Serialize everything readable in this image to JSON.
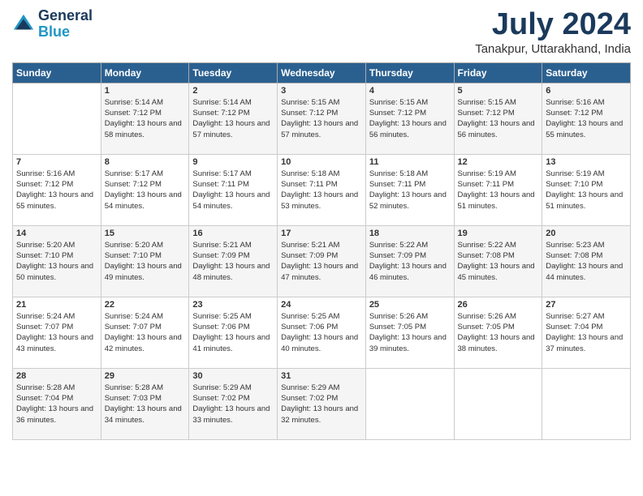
{
  "header": {
    "logo_line1": "General",
    "logo_line2": "Blue",
    "month_title": "July 2024",
    "location": "Tanakpur, Uttarakhand, India"
  },
  "days_of_week": [
    "Sunday",
    "Monday",
    "Tuesday",
    "Wednesday",
    "Thursday",
    "Friday",
    "Saturday"
  ],
  "weeks": [
    [
      {
        "day": "",
        "sunrise": "",
        "sunset": "",
        "daylight": ""
      },
      {
        "day": "1",
        "sunrise": "5:14 AM",
        "sunset": "7:12 PM",
        "daylight": "13 hours and 58 minutes."
      },
      {
        "day": "2",
        "sunrise": "5:14 AM",
        "sunset": "7:12 PM",
        "daylight": "13 hours and 57 minutes."
      },
      {
        "day": "3",
        "sunrise": "5:15 AM",
        "sunset": "7:12 PM",
        "daylight": "13 hours and 57 minutes."
      },
      {
        "day": "4",
        "sunrise": "5:15 AM",
        "sunset": "7:12 PM",
        "daylight": "13 hours and 56 minutes."
      },
      {
        "day": "5",
        "sunrise": "5:15 AM",
        "sunset": "7:12 PM",
        "daylight": "13 hours and 56 minutes."
      },
      {
        "day": "6",
        "sunrise": "5:16 AM",
        "sunset": "7:12 PM",
        "daylight": "13 hours and 55 minutes."
      }
    ],
    [
      {
        "day": "7",
        "sunrise": "5:16 AM",
        "sunset": "7:12 PM",
        "daylight": "13 hours and 55 minutes."
      },
      {
        "day": "8",
        "sunrise": "5:17 AM",
        "sunset": "7:12 PM",
        "daylight": "13 hours and 54 minutes."
      },
      {
        "day": "9",
        "sunrise": "5:17 AM",
        "sunset": "7:11 PM",
        "daylight": "13 hours and 54 minutes."
      },
      {
        "day": "10",
        "sunrise": "5:18 AM",
        "sunset": "7:11 PM",
        "daylight": "13 hours and 53 minutes."
      },
      {
        "day": "11",
        "sunrise": "5:18 AM",
        "sunset": "7:11 PM",
        "daylight": "13 hours and 52 minutes."
      },
      {
        "day": "12",
        "sunrise": "5:19 AM",
        "sunset": "7:11 PM",
        "daylight": "13 hours and 51 minutes."
      },
      {
        "day": "13",
        "sunrise": "5:19 AM",
        "sunset": "7:10 PM",
        "daylight": "13 hours and 51 minutes."
      }
    ],
    [
      {
        "day": "14",
        "sunrise": "5:20 AM",
        "sunset": "7:10 PM",
        "daylight": "13 hours and 50 minutes."
      },
      {
        "day": "15",
        "sunrise": "5:20 AM",
        "sunset": "7:10 PM",
        "daylight": "13 hours and 49 minutes."
      },
      {
        "day": "16",
        "sunrise": "5:21 AM",
        "sunset": "7:09 PM",
        "daylight": "13 hours and 48 minutes."
      },
      {
        "day": "17",
        "sunrise": "5:21 AM",
        "sunset": "7:09 PM",
        "daylight": "13 hours and 47 minutes."
      },
      {
        "day": "18",
        "sunrise": "5:22 AM",
        "sunset": "7:09 PM",
        "daylight": "13 hours and 46 minutes."
      },
      {
        "day": "19",
        "sunrise": "5:22 AM",
        "sunset": "7:08 PM",
        "daylight": "13 hours and 45 minutes."
      },
      {
        "day": "20",
        "sunrise": "5:23 AM",
        "sunset": "7:08 PM",
        "daylight": "13 hours and 44 minutes."
      }
    ],
    [
      {
        "day": "21",
        "sunrise": "5:24 AM",
        "sunset": "7:07 PM",
        "daylight": "13 hours and 43 minutes."
      },
      {
        "day": "22",
        "sunrise": "5:24 AM",
        "sunset": "7:07 PM",
        "daylight": "13 hours and 42 minutes."
      },
      {
        "day": "23",
        "sunrise": "5:25 AM",
        "sunset": "7:06 PM",
        "daylight": "13 hours and 41 minutes."
      },
      {
        "day": "24",
        "sunrise": "5:25 AM",
        "sunset": "7:06 PM",
        "daylight": "13 hours and 40 minutes."
      },
      {
        "day": "25",
        "sunrise": "5:26 AM",
        "sunset": "7:05 PM",
        "daylight": "13 hours and 39 minutes."
      },
      {
        "day": "26",
        "sunrise": "5:26 AM",
        "sunset": "7:05 PM",
        "daylight": "13 hours and 38 minutes."
      },
      {
        "day": "27",
        "sunrise": "5:27 AM",
        "sunset": "7:04 PM",
        "daylight": "13 hours and 37 minutes."
      }
    ],
    [
      {
        "day": "28",
        "sunrise": "5:28 AM",
        "sunset": "7:04 PM",
        "daylight": "13 hours and 36 minutes."
      },
      {
        "day": "29",
        "sunrise": "5:28 AM",
        "sunset": "7:03 PM",
        "daylight": "13 hours and 34 minutes."
      },
      {
        "day": "30",
        "sunrise": "5:29 AM",
        "sunset": "7:02 PM",
        "daylight": "13 hours and 33 minutes."
      },
      {
        "day": "31",
        "sunrise": "5:29 AM",
        "sunset": "7:02 PM",
        "daylight": "13 hours and 32 minutes."
      },
      {
        "day": "",
        "sunrise": "",
        "sunset": "",
        "daylight": ""
      },
      {
        "day": "",
        "sunrise": "",
        "sunset": "",
        "daylight": ""
      },
      {
        "day": "",
        "sunrise": "",
        "sunset": "",
        "daylight": ""
      }
    ]
  ],
  "labels": {
    "sunrise_prefix": "Sunrise: ",
    "sunset_prefix": "Sunset: ",
    "daylight_prefix": "Daylight: "
  }
}
